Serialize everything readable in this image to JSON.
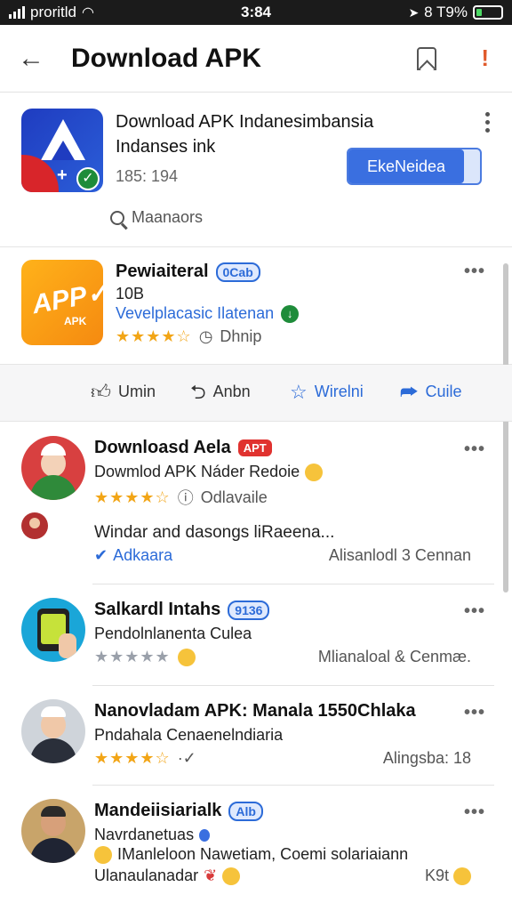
{
  "status_bar": {
    "carrier": "proritld",
    "time": "3:84",
    "battery": "8 T9%"
  },
  "app_bar": {
    "title": "Download APK"
  },
  "featured_app": {
    "name_line1": "Download APK Indanesimbansia",
    "name_line2": "Indanses ink",
    "meta": "185: 194",
    "install_label": "EkeNeidea",
    "search_label": "Maanaors"
  },
  "app2": {
    "name": "Pewiaiteral",
    "badge": "0Cab",
    "size": "10B",
    "developer": "Vevelplacasic Ilatenan",
    "rating": 3.5,
    "rating_text": "Dhnip"
  },
  "actions": [
    {
      "label": "Umin",
      "icon": "thumbs-up-icon"
    },
    {
      "label": "Anbn",
      "icon": "share-icon"
    },
    {
      "label": "Wirelni",
      "icon": "star-icon"
    },
    {
      "label": "Cuile",
      "icon": "forward-icon"
    }
  ],
  "reviews": [
    {
      "name": "Downloasd Aela",
      "badge": "APT",
      "text": "Dowmlod APK Náder Redoie",
      "rating": 4,
      "rating_text": "Odlavaile",
      "reply": "Windar and dasongs liRaeena...",
      "link": "Adkaara",
      "right_text": "Alisanlodl 3 Cennan"
    },
    {
      "name": "Salkardl Intahs",
      "badge": "9136",
      "text": "Pendolnlanenta Culea",
      "rating": 5,
      "right_text": "Mlianaloal & Cenmæ."
    },
    {
      "name": "Nanovladam APK: Manala 1550Chlaka",
      "text": "Pndahala Cenaenelndiaria",
      "rating": 4,
      "right_text": "Alingsba: 18"
    },
    {
      "name": "Mandeiisiarialk",
      "badge": "Alb",
      "text": "Navrdanetuas",
      "line2": "IManleloon Nawetiam, Coemi solariaiann",
      "line3": "Ulanaulanadar",
      "right_text": "K9t"
    }
  ],
  "colors": {
    "accent": "#2c6bd8",
    "star": "#f2a516",
    "badge_red": "#e0322f"
  }
}
